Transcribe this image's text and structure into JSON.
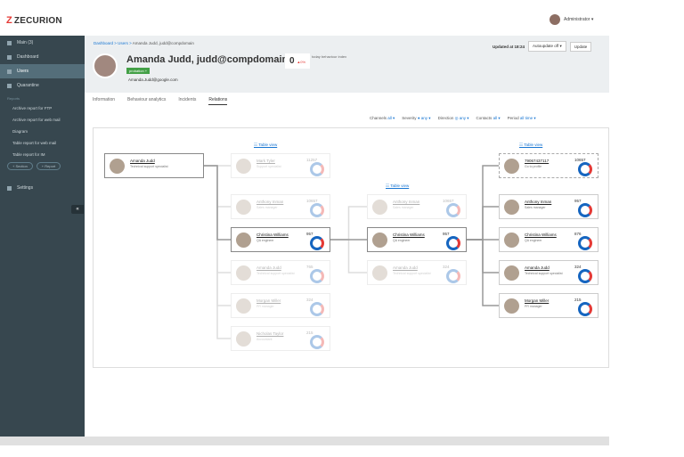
{
  "app": {
    "brand": "ZECURION",
    "user": "Administrator ▾"
  },
  "sidebar": {
    "items": [
      {
        "label": "Main (3)",
        "active": false
      },
      {
        "label": "Dashboard",
        "active": false
      },
      {
        "label": "Users",
        "active": true
      },
      {
        "label": "Quarantine",
        "active": false
      }
    ],
    "reports_head": "Reports",
    "reports": [
      "Archive report for FTP",
      "Archive report for web mail",
      "Diagram",
      "Table report for web mail",
      "Table report for IM"
    ],
    "pills": [
      "+ Section",
      "+ Report"
    ],
    "settings": "Settings",
    "collapse": "«"
  },
  "header": {
    "breadcrumb_link": "Dashboard > Users >",
    "breadcrumb_current": "Amanda Judd, judd@compdomain",
    "name": "Amanda Judd, judd@compdomain",
    "tag": "probation +",
    "email": "Amanda.Judd@google.com",
    "score": "0",
    "score_sub": "▲0%",
    "behaviour": "today behaviour index",
    "updated": "Updated at 18:24",
    "autoupdate": "Autoupdate off ▾",
    "update_btn": "Update"
  },
  "tabs": [
    "Information",
    "Behaviour analytics",
    "Incidents",
    "Relations"
  ],
  "filters": [
    {
      "label": "Channels",
      "value": "all ▾"
    },
    {
      "label": "Severity",
      "value": "● any ▾"
    },
    {
      "label": "Direction",
      "value": "◎ any ▾"
    },
    {
      "label": "Contacts",
      "value": "all ▾"
    },
    {
      "label": "Period",
      "value": "all time ▾"
    }
  ],
  "table_view": "☷ Table view",
  "cards": [
    {
      "name": "Amanda Judd",
      "role": "Technical support specialist",
      "val": "",
      "cls": "sel"
    },
    {
      "name": "Mark Tyler",
      "role": "Support specialist",
      "val": "11257",
      "cls": "dim"
    },
    {
      "name": "Anthony Inman",
      "role": "Sales manager",
      "val": "10657",
      "cls": "dim"
    },
    {
      "name": "Christina Williams",
      "role": "QA engineer",
      "val": "957",
      "cls": "sel"
    },
    {
      "name": "Amanda Judd",
      "role": "Technical support specialist",
      "val": "765",
      "cls": "dim"
    },
    {
      "name": "Morgan Miller",
      "role": "PR manager",
      "val": "324",
      "cls": "dim"
    },
    {
      "name": "Nicholas Taylor",
      "role": "Accountant",
      "val": "215",
      "cls": "dim"
    },
    {
      "name": "Anthony Inman",
      "role": "Sales manager",
      "val": "10657",
      "cls": "dim"
    },
    {
      "name": "Christina Williams",
      "role": "QA engineer",
      "val": "957",
      "cls": "sel"
    },
    {
      "name": "Amanda Judd",
      "role": "Technical support specialist",
      "val": "324",
      "cls": "dim"
    },
    {
      "name": "79067437117",
      "role": "Go to profile",
      "val": "10657",
      "cls": "dashed"
    },
    {
      "name": "Anthony Inman",
      "role": "Sales manager",
      "val": "957",
      "cls": ""
    },
    {
      "name": "Christina Williams",
      "role": "QA engineer",
      "val": "876",
      "cls": ""
    },
    {
      "name": "Amanda Judd",
      "role": "Technical support specialist",
      "val": "324",
      "cls": ""
    },
    {
      "name": "Morgan Miller",
      "role": "PR manager",
      "val": "215",
      "cls": ""
    }
  ]
}
